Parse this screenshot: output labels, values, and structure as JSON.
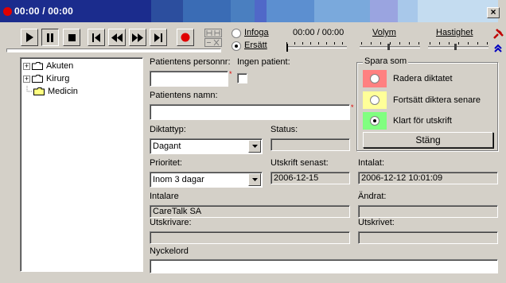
{
  "title": {
    "time": "00:00 / 00:00",
    "close": "×"
  },
  "player": {
    "mode_insert": "Infoga",
    "mode_replace": "Ersätt",
    "time_display": "00:00 / 00:00",
    "volume_label": "Volym",
    "speed_label": "Hastighet"
  },
  "tree": {
    "items": [
      {
        "label": "Akuten",
        "expander": "+"
      },
      {
        "label": "Kirurg",
        "expander": "+"
      },
      {
        "label": "Medicin",
        "expander": ""
      }
    ]
  },
  "form": {
    "personnr_label": "Patientens personnr:",
    "personnr_value": "",
    "no_patient_label": "Ingen patient:",
    "name_label": "Patientens namn:",
    "name_value": "",
    "dictation_type_label": "Diktattyp:",
    "dictation_type_value": "Dagant",
    "status_label": "Status:",
    "status_value": "",
    "priority_label": "Prioritet:",
    "priority_value": "Inom 3 dagar",
    "printout_label": "Utskrift senast:",
    "printout_value": "2006-12-15",
    "recorded_label": "Intalat:",
    "recorded_value": "2006-12-12 10:01:09",
    "speaker_label": "Intalare",
    "speaker_value": "CareTalk SA",
    "changed_label": "Ändrat:",
    "changed_value": "",
    "transcriber_label": "Utskrivare:",
    "transcriber_value": "",
    "transcribed_label": "Utskrivet:",
    "transcribed_value": "",
    "keyword_label": "Nyckelord",
    "keyword_value": ""
  },
  "save_as": {
    "title": "Spara som",
    "options": [
      {
        "label": "Radera diktatet",
        "color": "#ff8080"
      },
      {
        "label": "Fortsätt diktera senare",
        "color": "#ffff99"
      },
      {
        "label": "Klart för utskrift",
        "color": "#80ff80"
      }
    ],
    "selected": 2,
    "close_label": "Stäng"
  },
  "colors": {
    "title_gradient": [
      "#1a2a8c",
      "#3a6fb0",
      "#6a9fd0",
      "#9a7fc8",
      "#b0c8e8"
    ],
    "record": "#e00000",
    "pin": "#c00000",
    "collapse_arrows": "#0000c0"
  }
}
